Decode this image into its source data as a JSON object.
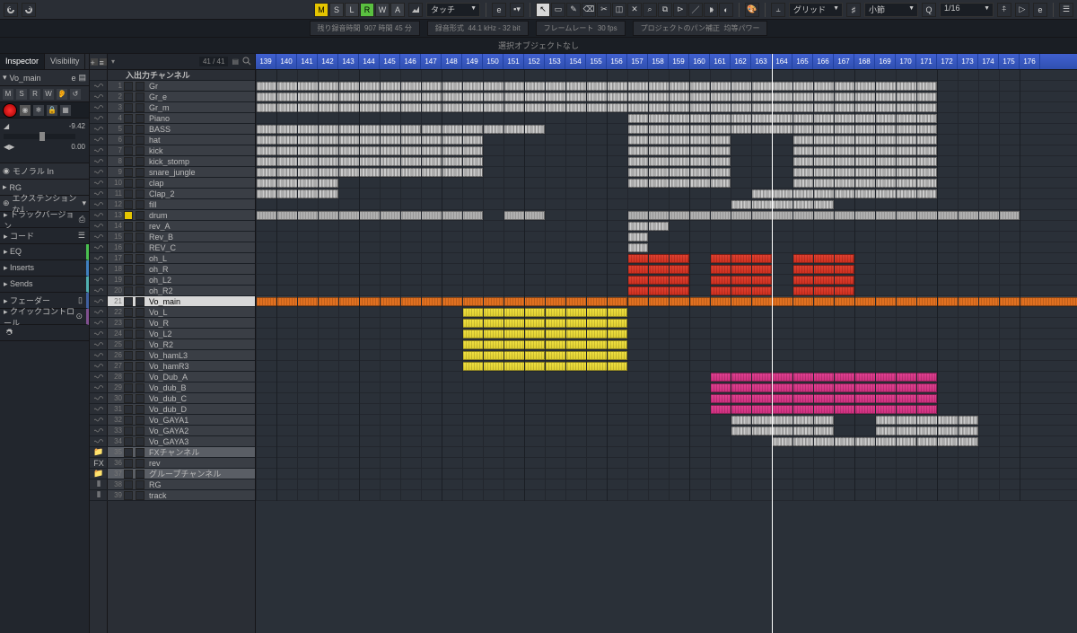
{
  "toolbar": {
    "m": "M",
    "s": "S",
    "l": "L",
    "r": "R",
    "w": "W",
    "a": "A",
    "automation_mode": "タッチ",
    "snap": "グリッド",
    "quantize": "小節",
    "zoom_value": "1/16"
  },
  "status": {
    "rec_remaining_label": "残り録音時間",
    "rec_remaining": "907 時間 45 分",
    "rec_format_label": "録音形式",
    "rec_format": "44.1 kHz - 32 bit",
    "framerate_label": "フレームレート",
    "framerate": "30 fps",
    "pan_law_label": "プロジェクトのパン補正",
    "pan_law": "均等パワー"
  },
  "infoline": "選択オブジェクトなし",
  "inspector": {
    "tab1": "Inspector",
    "tab2": "Visibility",
    "track_name": "Vo_main",
    "volume": "-9.42",
    "pan": "0.00",
    "routing1": "モノラル In",
    "routing2": "RG",
    "no_ext": "エクステンションなし",
    "tversion": "トラックバージョン",
    "chord": "コード",
    "eq": "EQ",
    "inserts": "Inserts",
    "sends": "Sends",
    "fader": "フェーダー",
    "quickctrl": "クイックコントロール"
  },
  "tracklist": {
    "counter": "41 / 41",
    "header": "入出力チャンネル"
  },
  "tracks": [
    {
      "n": 1,
      "name": "Gr",
      "type": "audio"
    },
    {
      "n": 2,
      "name": "Gr_e",
      "type": "audio"
    },
    {
      "n": 3,
      "name": "Gr_m",
      "type": "audio"
    },
    {
      "n": 4,
      "name": "Piano",
      "type": "audio"
    },
    {
      "n": 5,
      "name": "BASS",
      "type": "audio"
    },
    {
      "n": 6,
      "name": "hat",
      "type": "audio"
    },
    {
      "n": 7,
      "name": "kick",
      "type": "audio"
    },
    {
      "n": 8,
      "name": "kick_stomp",
      "type": "audio"
    },
    {
      "n": 9,
      "name": "snare_jungle",
      "type": "audio"
    },
    {
      "n": 10,
      "name": "clap",
      "type": "audio"
    },
    {
      "n": 11,
      "name": "Clap_2",
      "type": "audio"
    },
    {
      "n": 12,
      "name": "fill",
      "type": "audio"
    },
    {
      "n": 13,
      "name": "drum",
      "type": "audio",
      "muted": true
    },
    {
      "n": 14,
      "name": "rev_A",
      "type": "audio"
    },
    {
      "n": 15,
      "name": "Rev_B",
      "type": "audio"
    },
    {
      "n": 16,
      "name": "REV_C",
      "type": "audio"
    },
    {
      "n": 17,
      "name": "oh_L",
      "type": "audio"
    },
    {
      "n": 18,
      "name": "oh_R",
      "type": "audio"
    },
    {
      "n": 19,
      "name": "oh_L2",
      "type": "audio"
    },
    {
      "n": 20,
      "name": "oh_R2",
      "type": "audio"
    },
    {
      "n": 21,
      "name": "Vo_main",
      "type": "audio",
      "selected": true
    },
    {
      "n": 22,
      "name": "Vo_L",
      "type": "audio"
    },
    {
      "n": 23,
      "name": "Vo_R",
      "type": "audio"
    },
    {
      "n": 24,
      "name": "Vo_L2",
      "type": "audio"
    },
    {
      "n": 25,
      "name": "Vo_R2",
      "type": "audio"
    },
    {
      "n": 26,
      "name": "Vo_hamL3",
      "type": "audio"
    },
    {
      "n": 27,
      "name": "Vo_hamR3",
      "type": "audio"
    },
    {
      "n": 28,
      "name": "Vo_Dub_A",
      "type": "audio"
    },
    {
      "n": 29,
      "name": "Vo_dub_B",
      "type": "audio"
    },
    {
      "n": 30,
      "name": "Vo_dub_C",
      "type": "audio"
    },
    {
      "n": 31,
      "name": "Vo_dub_D",
      "type": "audio"
    },
    {
      "n": 32,
      "name": "Vo_GAYA1",
      "type": "audio"
    },
    {
      "n": 33,
      "name": "Vo_GAYA2",
      "type": "audio"
    },
    {
      "n": 34,
      "name": "Vo_GAYA3",
      "type": "audio"
    },
    {
      "n": 35,
      "name": "FXチャンネル",
      "type": "folder"
    },
    {
      "n": 36,
      "name": "rev",
      "type": "fx"
    },
    {
      "n": 37,
      "name": "グループチャンネル",
      "type": "folder"
    },
    {
      "n": 38,
      "name": "RG",
      "type": "group"
    },
    {
      "n": 39,
      "name": "track",
      "type": "group"
    }
  ],
  "ruler": {
    "start": 139,
    "end": 176
  },
  "playhead_bar": 164,
  "clips": [
    {
      "track": 1,
      "start": 139,
      "end": 172,
      "color": "gray"
    },
    {
      "track": 2,
      "start": 139,
      "end": 172,
      "color": "gray"
    },
    {
      "track": 3,
      "start": 139,
      "end": 172,
      "color": "gray"
    },
    {
      "track": 4,
      "start": 157,
      "end": 172,
      "color": "gray"
    },
    {
      "track": 5,
      "start": 139,
      "end": 147,
      "color": "gray"
    },
    {
      "track": 5,
      "start": 147,
      "end": 150,
      "color": "gray"
    },
    {
      "track": 5,
      "start": 150,
      "end": 153,
      "color": "gray"
    },
    {
      "track": 5,
      "start": 157,
      "end": 172,
      "color": "gray"
    },
    {
      "track": 6,
      "start": 139,
      "end": 150,
      "color": "gray"
    },
    {
      "track": 6,
      "start": 157,
      "end": 162,
      "color": "gray"
    },
    {
      "track": 6,
      "start": 165,
      "end": 172,
      "color": "gray"
    },
    {
      "track": 7,
      "start": 139,
      "end": 150,
      "color": "gray"
    },
    {
      "track": 7,
      "start": 157,
      "end": 162,
      "color": "gray"
    },
    {
      "track": 7,
      "start": 165,
      "end": 172,
      "color": "gray"
    },
    {
      "track": 8,
      "start": 139,
      "end": 150,
      "color": "gray"
    },
    {
      "track": 8,
      "start": 157,
      "end": 162,
      "color": "gray"
    },
    {
      "track": 8,
      "start": 165,
      "end": 172,
      "color": "gray"
    },
    {
      "track": 9,
      "start": 139,
      "end": 150,
      "color": "gray"
    },
    {
      "track": 9,
      "start": 157,
      "end": 162,
      "color": "gray"
    },
    {
      "track": 9,
      "start": 165,
      "end": 172,
      "color": "gray"
    },
    {
      "track": 10,
      "start": 139,
      "end": 143,
      "color": "gray"
    },
    {
      "track": 10,
      "start": 157,
      "end": 162,
      "color": "gray"
    },
    {
      "track": 10,
      "start": 165,
      "end": 172,
      "color": "gray"
    },
    {
      "track": 11,
      "start": 139,
      "end": 143,
      "color": "gray"
    },
    {
      "track": 11,
      "start": 163,
      "end": 172,
      "color": "gray"
    },
    {
      "track": 12,
      "start": 162,
      "end": 167,
      "color": "gray"
    },
    {
      "track": 13,
      "start": 139,
      "end": 150,
      "color": "gray-light"
    },
    {
      "track": 13,
      "start": 151,
      "end": 153,
      "color": "gray-light"
    },
    {
      "track": 13,
      "start": 157,
      "end": 176,
      "color": "gray-light"
    },
    {
      "track": 14,
      "start": 157,
      "end": 159,
      "color": "gray"
    },
    {
      "track": 15,
      "start": 157,
      "end": 158,
      "color": "gray"
    },
    {
      "track": 16,
      "start": 157,
      "end": 158,
      "color": "gray"
    },
    {
      "track": 17,
      "start": 157,
      "end": 160,
      "color": "red"
    },
    {
      "track": 17,
      "start": 161,
      "end": 164,
      "color": "red"
    },
    {
      "track": 17,
      "start": 165,
      "end": 168,
      "color": "red"
    },
    {
      "track": 18,
      "start": 157,
      "end": 160,
      "color": "red"
    },
    {
      "track": 18,
      "start": 161,
      "end": 164,
      "color": "red"
    },
    {
      "track": 18,
      "start": 165,
      "end": 168,
      "color": "red"
    },
    {
      "track": 19,
      "start": 157,
      "end": 160,
      "color": "red"
    },
    {
      "track": 19,
      "start": 161,
      "end": 164,
      "color": "red"
    },
    {
      "track": 19,
      "start": 165,
      "end": 168,
      "color": "red"
    },
    {
      "track": 20,
      "start": 157,
      "end": 160,
      "color": "red"
    },
    {
      "track": 20,
      "start": 161,
      "end": 164,
      "color": "red"
    },
    {
      "track": 20,
      "start": 165,
      "end": 168,
      "color": "red"
    },
    {
      "track": 21,
      "start": 139,
      "end": 157,
      "color": "orange"
    },
    {
      "track": 21,
      "start": 157,
      "end": 179,
      "color": "orange"
    },
    {
      "track": 22,
      "start": 149,
      "end": 153,
      "color": "yellow"
    },
    {
      "track": 22,
      "start": 153,
      "end": 157,
      "color": "yellow"
    },
    {
      "track": 23,
      "start": 149,
      "end": 153,
      "color": "yellow"
    },
    {
      "track": 23,
      "start": 153,
      "end": 157,
      "color": "yellow"
    },
    {
      "track": 24,
      "start": 149,
      "end": 153,
      "color": "yellow"
    },
    {
      "track": 24,
      "start": 153,
      "end": 157,
      "color": "yellow"
    },
    {
      "track": 25,
      "start": 149,
      "end": 153,
      "color": "yellow"
    },
    {
      "track": 25,
      "start": 153,
      "end": 157,
      "color": "yellow"
    },
    {
      "track": 26,
      "start": 149,
      "end": 153,
      "color": "yellow"
    },
    {
      "track": 26,
      "start": 153,
      "end": 157,
      "color": "yellow"
    },
    {
      "track": 27,
      "start": 149,
      "end": 153,
      "color": "yellow"
    },
    {
      "track": 27,
      "start": 153,
      "end": 157,
      "color": "yellow"
    },
    {
      "track": 28,
      "start": 161,
      "end": 164,
      "color": "pink"
    },
    {
      "track": 28,
      "start": 164,
      "end": 172,
      "color": "pink"
    },
    {
      "track": 29,
      "start": 161,
      "end": 164,
      "color": "pink"
    },
    {
      "track": 29,
      "start": 164,
      "end": 172,
      "color": "pink"
    },
    {
      "track": 30,
      "start": 161,
      "end": 164,
      "color": "pink"
    },
    {
      "track": 30,
      "start": 164,
      "end": 172,
      "color": "pink"
    },
    {
      "track": 31,
      "start": 161,
      "end": 164,
      "color": "pink"
    },
    {
      "track": 31,
      "start": 164,
      "end": 172,
      "color": "pink"
    },
    {
      "track": 32,
      "start": 162,
      "end": 167,
      "color": "gray"
    },
    {
      "track": 32,
      "start": 169,
      "end": 174,
      "color": "gray"
    },
    {
      "track": 33,
      "start": 162,
      "end": 167,
      "color": "gray"
    },
    {
      "track": 33,
      "start": 169,
      "end": 174,
      "color": "gray"
    },
    {
      "track": 34,
      "start": 164,
      "end": 171,
      "color": "gray"
    },
    {
      "track": 34,
      "start": 171,
      "end": 174,
      "color": "gray"
    }
  ]
}
